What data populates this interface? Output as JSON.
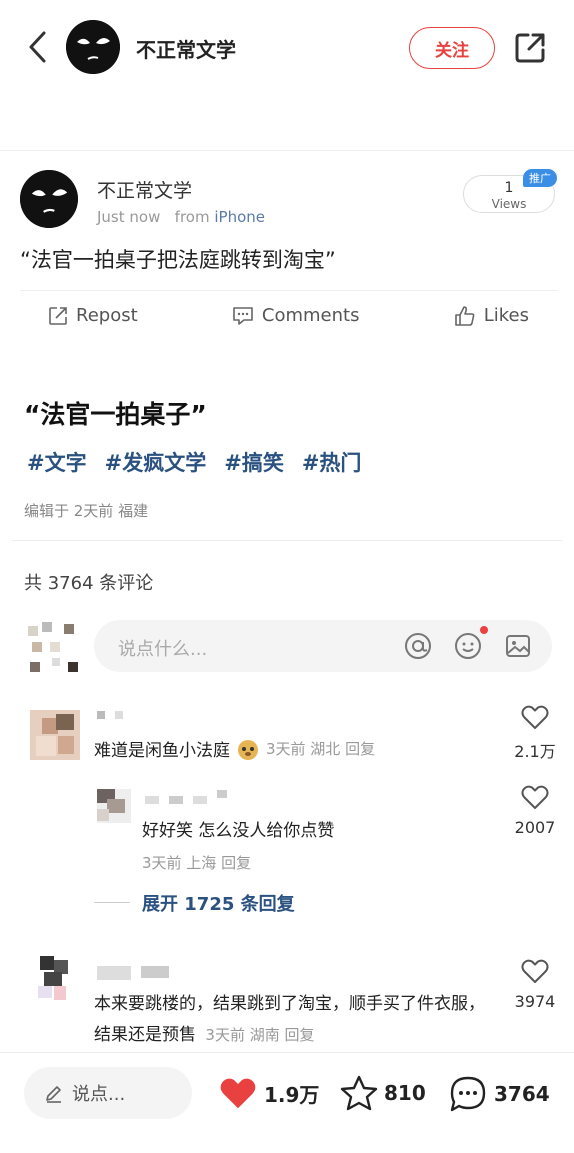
{
  "header": {
    "account_name": "不正常文学",
    "follow_label": "关注"
  },
  "post": {
    "author": "不正常文学",
    "time": "Just now",
    "from_label": "from",
    "source": "iPhone",
    "views_count": "1",
    "views_label": "Views",
    "promo_badge": "推广",
    "text": "“法官一拍桌子把法庭跳转到淘宝”",
    "actions": {
      "repost": "Repost",
      "comments": "Comments",
      "likes": "Likes"
    }
  },
  "article": {
    "title": "“法官一拍桌子”",
    "tags": [
      "#文字",
      "#发疯文学",
      "#搞笑",
      "#热门"
    ],
    "edited": "编辑于 2天前 福建"
  },
  "comments": {
    "total": "共 3764 条评论",
    "input_placeholder": "说点什么...",
    "items": [
      {
        "text": "难道是闲鱼小法庭",
        "info": "3天前 湖北 回复",
        "likes": "2.1万"
      },
      {
        "text": "好好笑 怎么没人给你点赞",
        "info": "3天前 上海 回复",
        "likes": "2007"
      },
      {
        "text": "本来要跳楼的，结果跳到了淘宝，顺手买了件衣服，结果还是预售",
        "info": "3天前 湖南 回复",
        "likes": "3974"
      }
    ],
    "expand_label": "展开 1725 条回复"
  },
  "bottom_bar": {
    "say_placeholder": "说点...",
    "likes": "1.9万",
    "favorites": "810",
    "comments": "3764"
  },
  "colors": {
    "accent_red": "#e8413f",
    "link_blue": "#2a5180",
    "promo_blue": "#3a8ee6"
  }
}
